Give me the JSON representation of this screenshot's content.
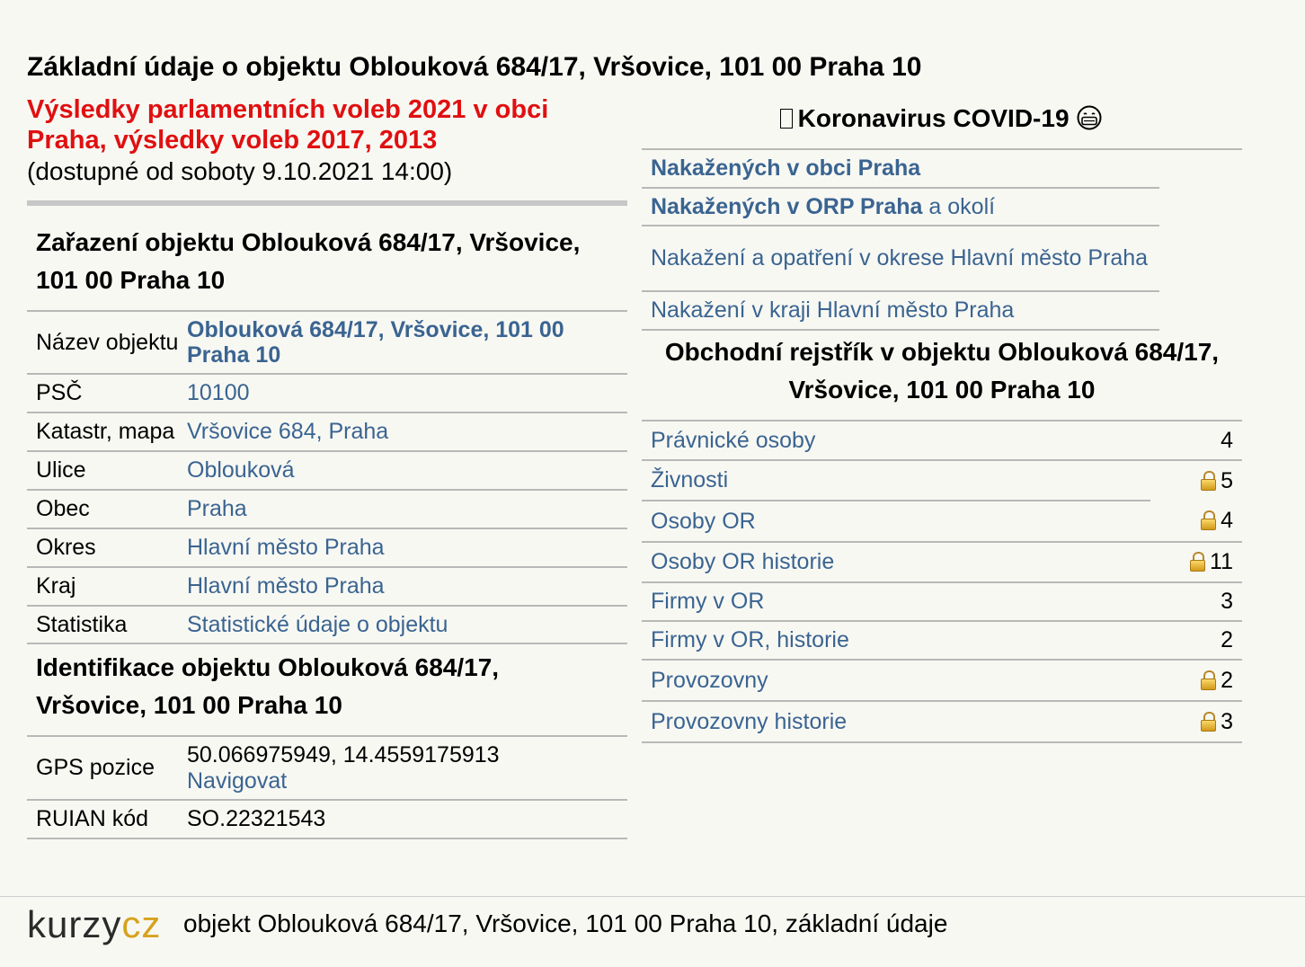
{
  "header": {
    "title": "Základní údaje o objektu Oblouková 684/17, Vršovice, 101 00 Praha 10",
    "election_link": "Výsledky parlamentních voleb 2021 v obci Praha, výsledky voleb 2017, 2013",
    "availability_note": "(dostupné od soboty 9.10.2021 14:00)"
  },
  "classification": {
    "heading": "Zařazení objektu Oblouková 684/17, Vršovice, 101 00 Praha 10",
    "rows": [
      {
        "label": "Název objektu",
        "value": "Oblouková 684/17, Vršovice, 101 00 Praha 10"
      },
      {
        "label": "PSČ",
        "value": "10100"
      },
      {
        "label": "Katastr, mapa",
        "value": "Vršovice 684, Praha"
      },
      {
        "label": "Ulice",
        "value": "Oblouková"
      },
      {
        "label": "Obec",
        "value": "Praha"
      },
      {
        "label": "Okres",
        "value": "Hlavní město Praha"
      },
      {
        "label": "Kraj",
        "value": "Hlavní město Praha"
      },
      {
        "label": "Statistika",
        "value": "Statistické údaje o objektu"
      }
    ]
  },
  "identification": {
    "heading": "Identifikace objektu Oblouková 684/17, Vršovice, 101 00 Praha 10",
    "gps_label": "GPS pozice",
    "gps_value": "50.066975949, 14.4559175913",
    "navigate_label": "Navigovat",
    "ruian_label": "RUIAN kód",
    "ruian_value": "SO.22321543"
  },
  "covid": {
    "heading": "Koronavirus COVID-19",
    "links": [
      {
        "strong": "Nakažených v obci Praha",
        "rest": ""
      },
      {
        "strong": "Nakažených v ORP Praha",
        "rest": " a okolí"
      },
      {
        "strong": "",
        "rest": "Nakažení a opatření v okrese Hlavní město Praha"
      },
      {
        "strong": "",
        "rest": "Nakažení v kraji Hlavní město Praha"
      }
    ]
  },
  "register": {
    "heading": "Obchodní rejstřík v objektu Oblouková 684/17, Vršovice, 101 00 Praha 10",
    "rows": [
      {
        "label": "Právnické osoby",
        "count": "4",
        "locked": false
      },
      {
        "label": "Živnosti",
        "count": "5",
        "locked": true
      },
      {
        "label": "Osoby OR",
        "count": "4",
        "locked": true
      },
      {
        "label": "Osoby OR historie",
        "count": "11",
        "locked": true
      },
      {
        "label": "Firmy v OR",
        "count": "3",
        "locked": false
      },
      {
        "label": "Firmy v OR, historie",
        "count": "2",
        "locked": false
      },
      {
        "label": "Provozovny",
        "count": "2",
        "locked": true
      },
      {
        "label": "Provozovny historie",
        "count": "3",
        "locked": true
      }
    ]
  },
  "footer": {
    "logo_text_1": "kurzy",
    "logo_text_2": "cz",
    "caption": "objekt Oblouková 684/17, Vršovice, 101 00 Praha 10, základní údaje"
  },
  "colors": {
    "link": "#3a6491",
    "election": "#e01010",
    "logo_gold": "#d6a21e"
  }
}
